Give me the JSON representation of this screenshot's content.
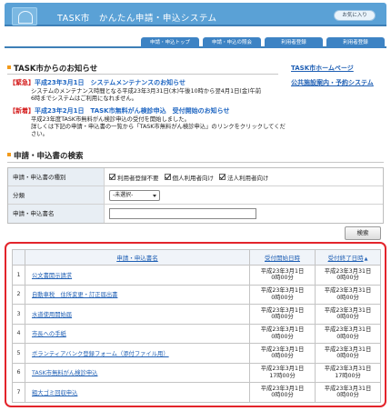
{
  "header": {
    "title": "TASK市　かんたん申請・申込システム",
    "favorites_label": "お気に入り",
    "nav_tabs": [
      "申請・申込トップ",
      "申請・申込の照会",
      "利用者登録",
      "利用者登録"
    ]
  },
  "notices": {
    "title": "TASK市からのお知らせ",
    "items": [
      {
        "tag": "【緊急】",
        "head": "平成23年3月1日　システムメンテナンスのお知らせ",
        "body": [
          "システムのメンテナンス時間となる平成23年3月31日(木)午後10時から翌4月1日(金)午前",
          "6時までシステムはご利用になれません。"
        ]
      },
      {
        "tag": "【新着】",
        "head": "平成23年2月1日　TASK市無料がん検診申込　受付開始のお知らせ",
        "body": [
          "平成23年度TASK市無料がん検診申込の受付を開始しました。",
          "詳しくは下記の申請・申込書の一覧から「TASK市無料がん検診申込」のリンクをクリックしてくだ",
          "さい。"
        ]
      }
    ]
  },
  "side_links": [
    "TASK市ホームページ",
    "公共施設案内・予約システム"
  ],
  "search": {
    "title": "申請・申込書の検索",
    "rows": [
      {
        "label": "申請・申込書の種別",
        "checks": [
          {
            "label": "利用者登録不要",
            "checked": true
          },
          {
            "label": "個人利用者向け",
            "checked": true
          },
          {
            "label": "法人利用者向け",
            "checked": true
          }
        ]
      },
      {
        "label": "分類",
        "select_value": "-未選択-"
      },
      {
        "label": "申請・申込書名",
        "input_value": ""
      }
    ],
    "button": "検索"
  },
  "results": {
    "headers": {
      "name": "申請・申込書名",
      "start": "受付開始日時",
      "end": "受付終了日時",
      "sort_mark": "▲"
    },
    "rows": [
      {
        "num": "1",
        "name": "公文書開示請求",
        "start": [
          "平成23年3月1日",
          "0時00分"
        ],
        "end": [
          "平成23年3月31日",
          "0時00分"
        ]
      },
      {
        "num": "2",
        "name": "自動車税　住所変更・訂正届出書",
        "start": [
          "平成23年3月1日",
          "0時00分"
        ],
        "end": [
          "平成23年3月31日",
          "0時00分"
        ]
      },
      {
        "num": "3",
        "name": "水道使用開始届",
        "start": [
          "平成23年3月1日",
          "0時00分"
        ],
        "end": [
          "平成23年3月31日",
          "0時00分"
        ]
      },
      {
        "num": "4",
        "name": "市長への手紙",
        "start": [
          "平成23年3月1日",
          "0時00分"
        ],
        "end": [
          "平成23年3月31日",
          "0時00分"
        ]
      },
      {
        "num": "5",
        "name": "ボランティアバンク登録フォーム（添付ファイル用）",
        "start": [
          "平成23年3月1日",
          "0時00分"
        ],
        "end": [
          "平成23年3月31日",
          "0時00分"
        ]
      },
      {
        "num": "6",
        "name": "TASK市無料がん検診申込",
        "start": [
          "平成23年3月1日",
          "17時00分"
        ],
        "end": [
          "平成23年3月31日",
          "17時00分"
        ]
      },
      {
        "num": "7",
        "name": "粗大ゴミ回収申込",
        "start": [
          "平成23年3月1日",
          "0時00分"
        ],
        "end": [
          "平成23年3月31日",
          "0時00分"
        ]
      }
    ]
  }
}
